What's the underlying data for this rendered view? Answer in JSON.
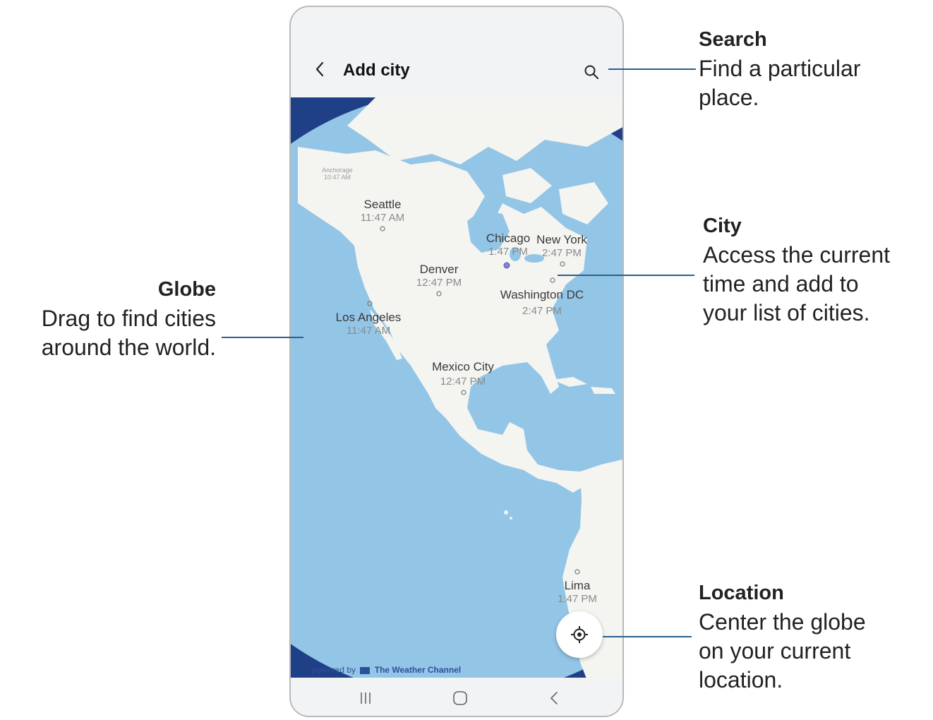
{
  "app": {
    "title": "Add city",
    "attribution_prefix": "powered by",
    "attribution_brand": "The Weather Channel"
  },
  "icons": {
    "back": "chevron-left-icon",
    "search": "search-icon",
    "location": "current-location-icon",
    "nav_recents": "recent-apps-icon",
    "nav_home": "home-icon",
    "nav_back": "back-icon"
  },
  "colors": {
    "ocean": "#1f3f86",
    "globe_water": "#93c5e6",
    "land": "#f4f4f1",
    "callout_line": "#2a5f8f"
  },
  "cities": [
    {
      "name": "Anchorage",
      "time": "10:47 AM"
    },
    {
      "name": "Seattle",
      "time": "11:47 AM"
    },
    {
      "name": "Chicago",
      "time": "1:47 PM"
    },
    {
      "name": "New York",
      "time": "2:47 PM"
    },
    {
      "name": "Denver",
      "time": "12:47 PM"
    },
    {
      "name": "Washington DC",
      "time": "2:47 PM"
    },
    {
      "name": "Los Angeles",
      "time": "11:47 AM"
    },
    {
      "name": "Mexico City",
      "time": "12:47 PM"
    },
    {
      "name": "Lima",
      "time": "1:47 PM"
    }
  ],
  "callouts": {
    "search": {
      "heading": "Search",
      "line1": "Find a particular",
      "line2": "place."
    },
    "city": {
      "heading": "City",
      "line1": "Access the current",
      "line2": "time and add to",
      "line3": "your list of cities."
    },
    "globe": {
      "heading": "Globe",
      "line1": "Drag to find cities",
      "line2": "around the world."
    },
    "location": {
      "heading": "Location",
      "line1": "Center the globe",
      "line2": "on your current",
      "line3": "location."
    }
  }
}
